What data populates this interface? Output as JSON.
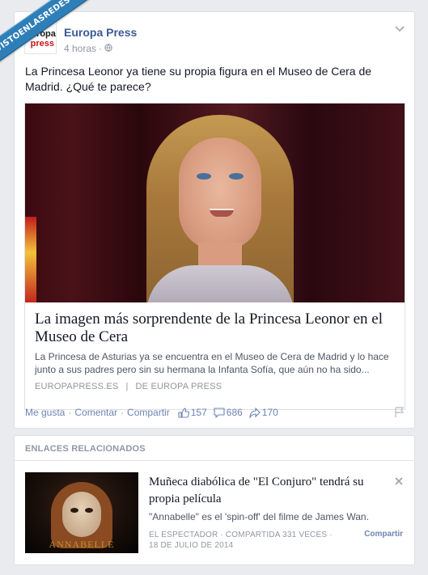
{
  "watermark": "VISTOENLASREDES",
  "post": {
    "page_name": "Europa Press",
    "avatar_line1": "Europa",
    "avatar_line2": "press",
    "time": "4 horas",
    "audience_icon": "globe-icon",
    "text": "La Princesa Leonor ya tiene su propia figura en el Museo de Cera de Madrid. ¿Qué te parece?",
    "link": {
      "title": "La imagen más sorprendente de la Princesa Leonor en el Museo de Cera",
      "description": "La Princesa de Asturias ya se encuentra en el Museo de Cera de Madrid y lo hace junto a sus padres pero sin su hermana la Infanta Sofía, que aún no ha sido...",
      "domain": "EUROPAPRESS.ES",
      "by": "DE EUROPA PRESS"
    },
    "actions": {
      "like": "Me gusta",
      "comment": "Comentar",
      "share": "Compartir",
      "likes": "157",
      "comments": "686",
      "shares": "170"
    }
  },
  "related": {
    "heading": "ENLACES RELACIONADOS",
    "title": "Muñeca diabólica de \"El Conjuro\" tendrá su propia película",
    "description": "\"Annabelle\" es el 'spin-off' del filme de James Wan.",
    "meta_line1": "EL ESPECTADOR · COMPARTIDA 331 VECES ·",
    "meta_line2": "18 DE JULIO DE 2014",
    "share": "Compartir",
    "thumb_text": "ANNABELLE"
  },
  "colors": {
    "link_blue": "#3b5998",
    "accent": "#6d84b4",
    "ribbon": "#2e7fb8"
  }
}
